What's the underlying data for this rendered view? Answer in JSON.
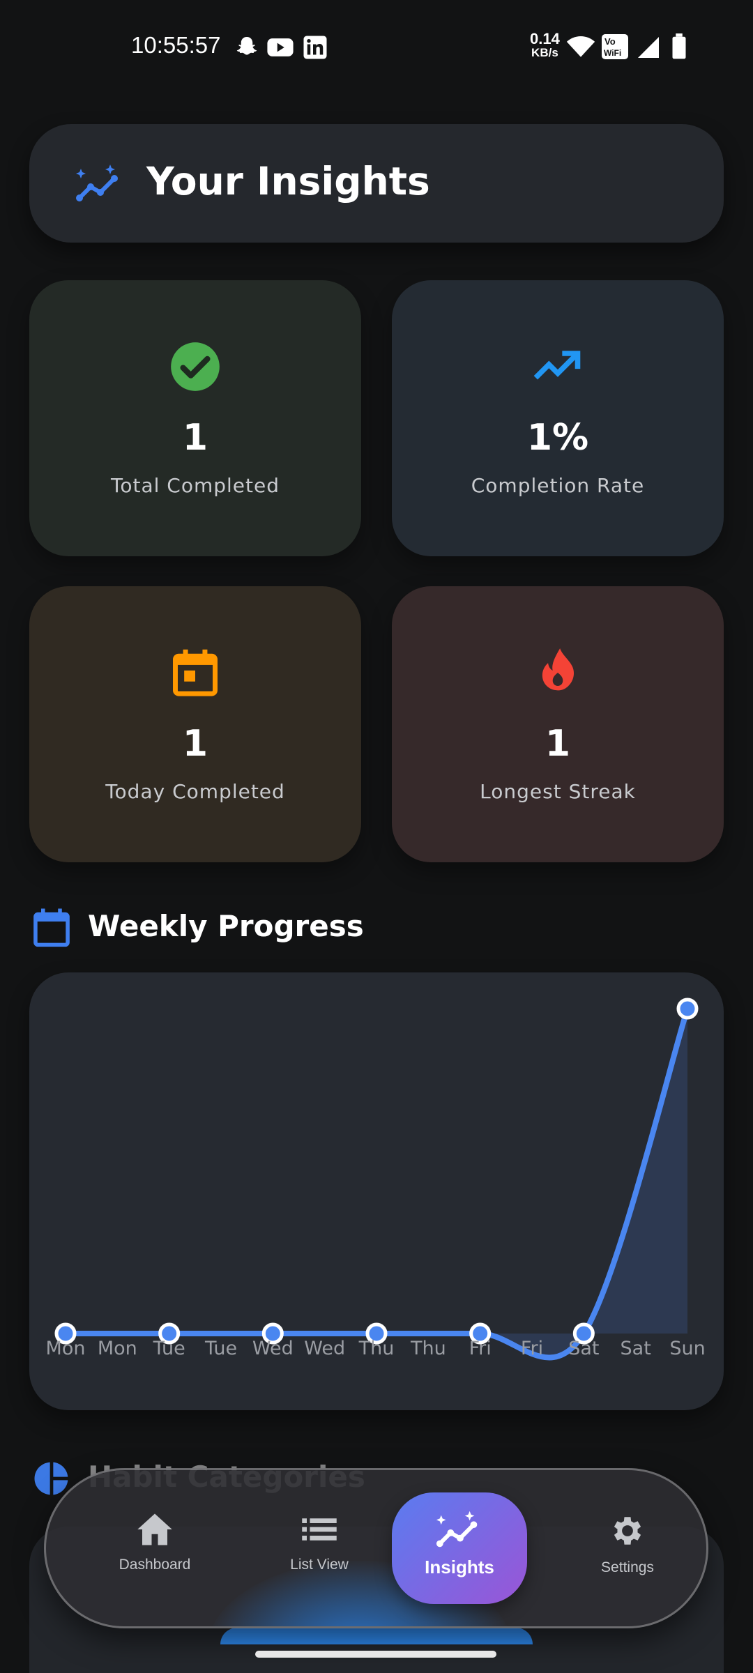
{
  "status_bar": {
    "time": "10:55:57",
    "net_speed_value": "0.14",
    "net_speed_unit": "KB/s",
    "icons": [
      "snapchat-icon",
      "youtube-icon",
      "linkedin-icon",
      "wifi-icon",
      "vowifi-icon",
      "signal-icon",
      "battery-icon"
    ],
    "vowifi_top": "Vo",
    "vowifi_bottom": "WiFi"
  },
  "header": {
    "title": "Your Insights",
    "icon": "insights-icon"
  },
  "stats": [
    {
      "value": "1",
      "label": "Total Completed",
      "icon": "check-circle-icon",
      "color": "#4caf50"
    },
    {
      "value": "1%",
      "label": "Completion Rate",
      "icon": "trending-up-icon",
      "color": "#2196f3"
    },
    {
      "value": "1",
      "label": "Today Completed",
      "icon": "calendar-today-icon",
      "color": "#ff9800"
    },
    {
      "value": "1",
      "label": "Longest Streak",
      "icon": "fire-icon",
      "color": "#f44336"
    }
  ],
  "weekly": {
    "title": "Weekly Progress",
    "icon": "calendar-icon"
  },
  "chart_data": {
    "type": "line",
    "categories": [
      "Mon",
      "Mon",
      "Tue",
      "Tue",
      "Wed",
      "Wed",
      "Thu",
      "Thu",
      "Fri",
      "Fri",
      "Sat",
      "Sat",
      "Sun"
    ],
    "series": [
      {
        "x": [
          "Mon",
          "Tue",
          "Wed",
          "Thu",
          "Fri",
          "Sat",
          "Sun"
        ],
        "values": [
          0,
          0,
          0,
          0,
          0,
          0,
          1
        ]
      }
    ],
    "ylim": [
      0,
      1
    ],
    "color": "#4a86f0",
    "grid": false
  },
  "categories_section": {
    "title": "Habit Categories",
    "icon": "pie-chart-icon"
  },
  "nav": {
    "items": [
      {
        "label": "Dashboard",
        "icon": "home-icon"
      },
      {
        "label": "List View",
        "icon": "list-icon"
      },
      {
        "label": "Insights",
        "icon": "insights-icon",
        "active": true
      },
      {
        "label": "Settings",
        "icon": "gear-icon"
      }
    ]
  },
  "colors": {
    "accent": "#4a86f0",
    "background": "#121314",
    "card": "#262a31"
  }
}
